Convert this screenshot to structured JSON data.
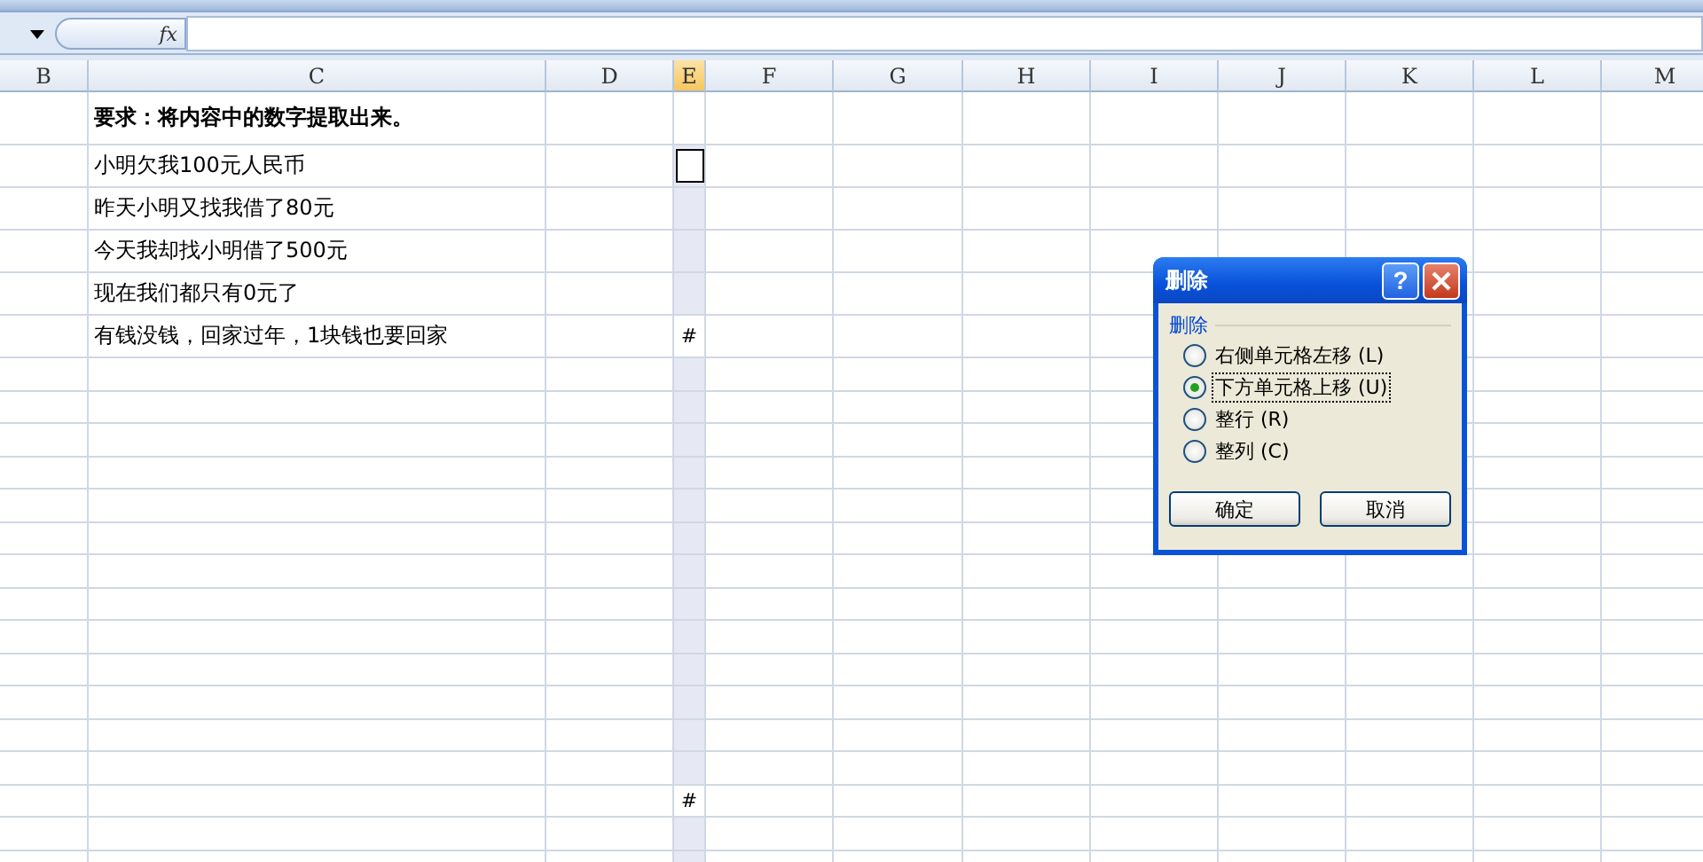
{
  "formula_bar": {
    "fx_label": "fx"
  },
  "columns": [
    {
      "label": "B",
      "selected": false
    },
    {
      "label": "C",
      "selected": false
    },
    {
      "label": "D",
      "selected": false
    },
    {
      "label": "E",
      "selected": true
    },
    {
      "label": "F",
      "selected": false
    },
    {
      "label": "G",
      "selected": false
    },
    {
      "label": "H",
      "selected": false
    },
    {
      "label": "I",
      "selected": false
    },
    {
      "label": "J",
      "selected": false
    },
    {
      "label": "K",
      "selected": false
    },
    {
      "label": "L",
      "selected": false
    },
    {
      "label": "M",
      "selected": false
    }
  ],
  "rows": [
    {
      "c": "要求：将内容中的数字提取出来。",
      "c_bold": true,
      "e": "",
      "e_selected": false
    },
    {
      "c": "小明欠我100元人民币",
      "e": "",
      "e_selected": true,
      "e_active": true
    },
    {
      "c": "昨天小明又找我借了80元",
      "e": "",
      "e_selected": true
    },
    {
      "c": "今天我却找小明借了500元",
      "e": "",
      "e_selected": true
    },
    {
      "c": "现在我们都只有0元了",
      "e": "",
      "e_selected": true
    },
    {
      "c": "有钱没钱，回家过年，1块钱也要回家",
      "e": "#",
      "e_selected": false
    },
    {
      "c": "",
      "e": "",
      "e_selected": true
    },
    {
      "c": "",
      "e": "",
      "e_selected": true
    },
    {
      "c": "",
      "e": "",
      "e_selected": true
    },
    {
      "c": "",
      "e": "",
      "e_selected": true
    },
    {
      "c": "",
      "e": "",
      "e_selected": true
    },
    {
      "c": "",
      "e": "",
      "e_selected": true
    },
    {
      "c": "",
      "e": "",
      "e_selected": true
    },
    {
      "c": "",
      "e": "",
      "e_selected": true
    },
    {
      "c": "",
      "e": "",
      "e_selected": true
    },
    {
      "c": "",
      "e": "",
      "e_selected": true
    },
    {
      "c": "",
      "e": "",
      "e_selected": true
    },
    {
      "c": "",
      "e": "",
      "e_selected": true
    },
    {
      "c": "",
      "e": "",
      "e_selected": true
    },
    {
      "c": "",
      "e": "#",
      "e_selected": false
    },
    {
      "c": "",
      "e": "",
      "e_selected": true
    },
    {
      "c": "",
      "e": "",
      "e_selected": true
    }
  ],
  "dialog": {
    "title": "删除",
    "group_label": "删除",
    "options": [
      {
        "label": "右侧单元格左移",
        "key": "(L)",
        "selected": false
      },
      {
        "label": "下方单元格上移",
        "key": "(U)",
        "selected": true
      },
      {
        "label": "整行",
        "key": "(R)",
        "selected": false
      },
      {
        "label": "整列",
        "key": "(C)",
        "selected": false
      }
    ],
    "help_button": "?",
    "ok_button": "确定",
    "cancel_button": "取消"
  }
}
